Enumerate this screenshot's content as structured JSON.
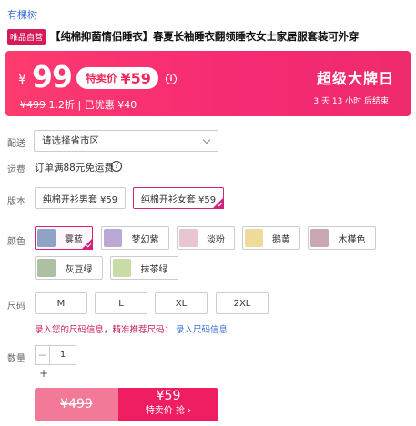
{
  "store": {
    "name": "有棵树"
  },
  "product": {
    "badge": "唯品自营",
    "title": "【纯棉抑菌情侣睡衣】春夏长袖睡衣翻领睡衣女士家居服套装可外穿"
  },
  "price": {
    "currency": "¥",
    "vip_price": "99",
    "special_label": "特卖价",
    "special_price": "¥59",
    "original_price": "¥499",
    "discount": "1.2折",
    "saved": "已优惠 ¥40",
    "event_name": "超级大牌日",
    "countdown": "3 天 13 小时 后结束",
    "colors": {
      "banner": "#f52a74",
      "accent": "#d0237a",
      "link": "#3a6ed8"
    }
  },
  "delivery": {
    "label": "配送",
    "select_value": "请选择省市区"
  },
  "shipping": {
    "label": "运费",
    "text": "订单满88元免运费",
    "help_icon": "question-circle-icon"
  },
  "version": {
    "label": "版本",
    "options": [
      "纯棉开衫男套 ¥59",
      "纯棉开衫女套 ¥59"
    ],
    "selected": 1
  },
  "color": {
    "label": "颜色",
    "options": [
      {
        "name": "雾蓝",
        "thumb": "#8fa3c7"
      },
      {
        "name": "梦幻紫",
        "thumb": "#b9a9d4"
      },
      {
        "name": "淡粉",
        "thumb": "#e9c6cf"
      },
      {
        "name": "鹅黄",
        "thumb": "#f0dc9a"
      },
      {
        "name": "木槿色",
        "thumb": "#c9a7b4"
      },
      {
        "name": "灰豆绿",
        "thumb": "#aec0a3"
      },
      {
        "name": "抹茶绿",
        "thumb": "#c9dba6"
      }
    ],
    "selected": 0
  },
  "size": {
    "label": "尺码",
    "options": [
      "M",
      "L",
      "XL",
      "2XL"
    ],
    "tip": "录入您的尺码信息，精准推荐尺码：",
    "tip_link": "录入尺码信息"
  },
  "quantity": {
    "label": "数量",
    "minus": "−",
    "value": "1",
    "plus": "+"
  },
  "buy": {
    "old_price": "¥499",
    "price": "¥59",
    "action": "特卖价 抢 ›"
  }
}
